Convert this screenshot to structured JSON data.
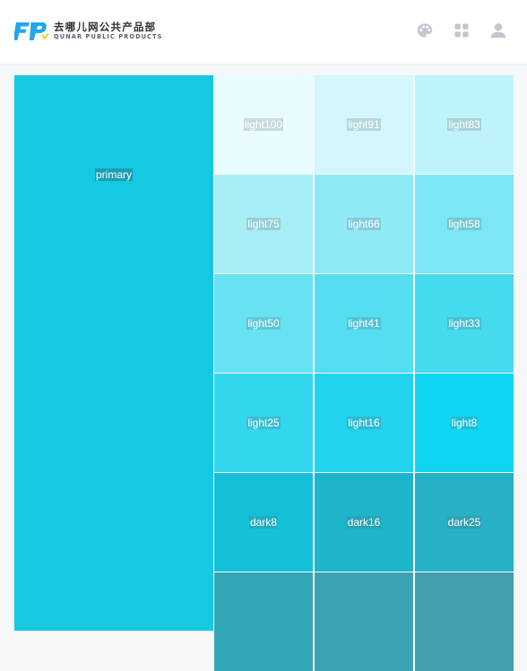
{
  "header": {
    "logo_cn": "去哪儿网公共产品部",
    "logo_en": "QUNAR PUBLIC PRODUCTS",
    "icons": [
      "palette-icon",
      "apps-grid-icon",
      "user-icon"
    ],
    "colors": {
      "logo_blue": "#1fa7f0",
      "logo_yellow": "#ffcc00",
      "icon_gray": "#c2c7cf"
    }
  },
  "palette": {
    "primary": {
      "label": "primary",
      "color": "#14c9e0"
    },
    "swatches": [
      {
        "label": "light100",
        "color": "#e8fbfe"
      },
      {
        "label": "light91",
        "color": "#d3f7fc"
      },
      {
        "label": "light83",
        "color": "#bef3f9"
      },
      {
        "label": "light75",
        "color": "#a7eef7"
      },
      {
        "label": "light66",
        "color": "#90eaf6"
      },
      {
        "label": "light58",
        "color": "#7be6f4"
      },
      {
        "label": "light50",
        "color": "#66e2f2"
      },
      {
        "label": "light41",
        "color": "#55def1"
      },
      {
        "label": "light33",
        "color": "#45dbef"
      },
      {
        "label": "light25",
        "color": "#33d7ed"
      },
      {
        "label": "light16",
        "color": "#22d3ec"
      },
      {
        "label": "light8",
        "color": "#0fd5f0"
      },
      {
        "label": "dark8",
        "color": "#14c0d8"
      },
      {
        "label": "dark16",
        "color": "#1cb5c9"
      },
      {
        "label": "dark25",
        "color": "#27b1c6"
      },
      {
        "label": "",
        "color": "#34a7b6"
      },
      {
        "label": "",
        "color": "#3aa3b1"
      },
      {
        "label": "",
        "color": "#419fae"
      }
    ]
  }
}
